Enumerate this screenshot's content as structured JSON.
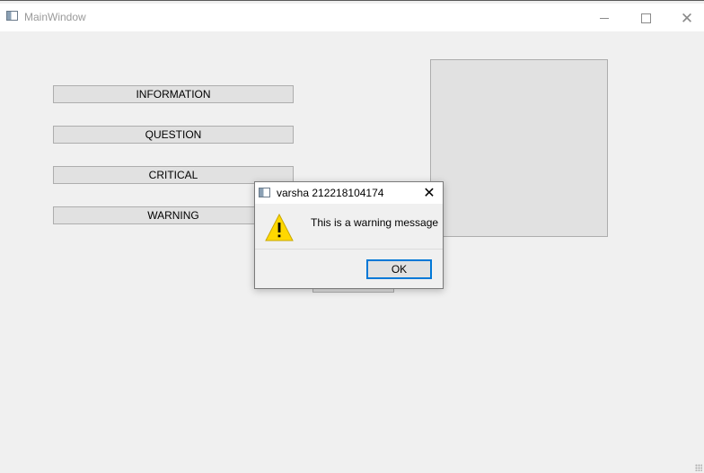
{
  "window": {
    "title": "MainWindow",
    "minimize_icon": "minimize-icon",
    "maximize_icon": "maximize-icon",
    "close_icon": "close-icon"
  },
  "buttons": [
    {
      "label": "INFORMATION"
    },
    {
      "label": "QUESTION"
    },
    {
      "label": "CRITICAL"
    },
    {
      "label": "WARNING"
    }
  ],
  "dialog": {
    "title": "varsha 212218104174",
    "message": "This is a warning message",
    "ok_label": "OK",
    "icon": "warning-icon",
    "close_glyph": "✕"
  },
  "colors": {
    "accent": "#0078d7",
    "warning_yellow": "#ffd800",
    "background": "#f0f0f0"
  }
}
